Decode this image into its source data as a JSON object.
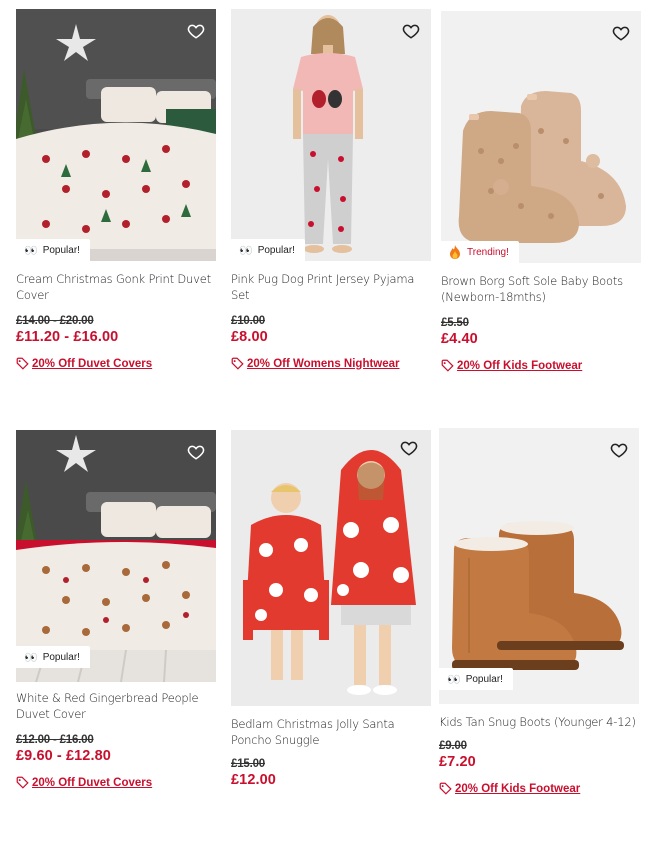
{
  "colors": {
    "accent": "#c8102e",
    "text": "#222222"
  },
  "products": [
    {
      "title": "Cream Christmas Gonk Print Duvet Cover",
      "was_price": "£14.00 - £20.00",
      "now_price": "£11.20 - £16.00",
      "promo": "20% Off Duvet Covers",
      "badge": "Popular!",
      "badge_icon": "eyes-icon"
    },
    {
      "title": "Pink Pug Dog Print Jersey Pyjama Set",
      "was_price": "£10.00",
      "now_price": "£8.00",
      "promo": "20% Off Womens Nightwear",
      "badge": "Popular!",
      "badge_icon": "eyes-icon"
    },
    {
      "title": "Brown Borg Soft Sole Baby Boots (Newborn-18mths)",
      "was_price": "£5.50",
      "now_price": "£4.40",
      "promo": "20% Off Kids Footwear",
      "badge": "Trending!",
      "badge_icon": "flame-icon"
    },
    {
      "title": "White & Red Gingerbread People Duvet Cover",
      "was_price": "£12.00 - £16.00",
      "now_price": "£9.60 - £12.80",
      "promo": "20% Off Duvet Covers",
      "badge": "Popular!",
      "badge_icon": "eyes-icon"
    },
    {
      "title": "Bedlam Christmas Jolly Santa Poncho Snuggle",
      "was_price": "£15.00",
      "now_price": "£12.00",
      "promo": "",
      "badge": "",
      "badge_icon": ""
    },
    {
      "title": "Kids Tan Snug Boots (Younger 4-12)",
      "was_price": "£9.00",
      "now_price": "£7.20",
      "promo": "20% Off Kids Footwear",
      "badge": "Popular!",
      "badge_icon": "eyes-icon"
    }
  ]
}
